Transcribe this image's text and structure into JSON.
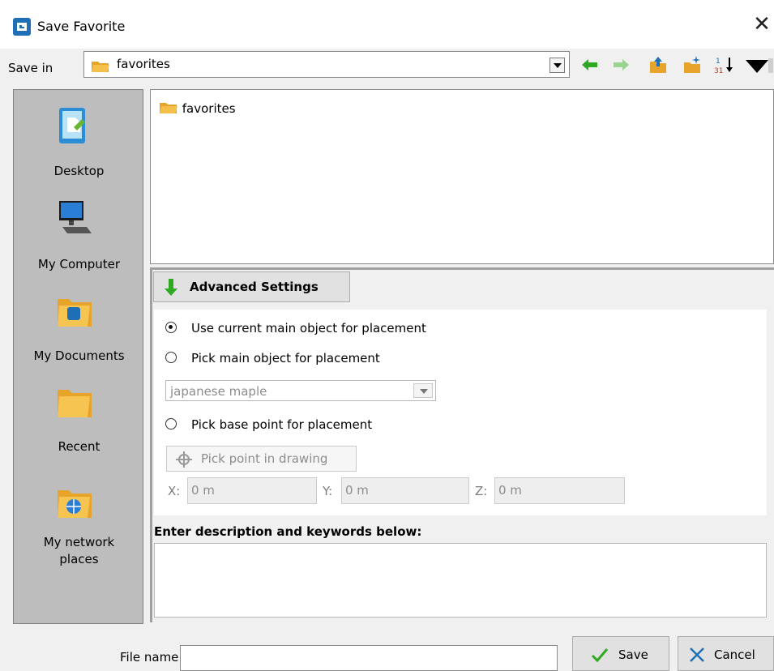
{
  "window": {
    "title": "Save Favorite",
    "close_glyph": "✕"
  },
  "save_in": {
    "label": "Save in",
    "value": "favorites"
  },
  "toolbar": {
    "icons": [
      "back-arrow-icon",
      "forward-arrow-icon",
      "up-folder-icon",
      "new-folder-icon",
      "sort-icon",
      "view-menu-icon"
    ],
    "colors": {
      "back": "#2eaa22",
      "forward": "#9ad28f"
    }
  },
  "places": [
    {
      "label": "Desktop",
      "icon": "desktop-icon"
    },
    {
      "label": "My Computer",
      "icon": "computer-icon"
    },
    {
      "label": "My Documents",
      "icon": "documents-folder-icon"
    },
    {
      "label": "Recent",
      "icon": "recent-folder-icon"
    },
    {
      "label": "My network\nplaces",
      "icon": "network-places-icon"
    }
  ],
  "file_list": {
    "items": [
      {
        "name": "favorites",
        "icon": "folder-icon"
      }
    ]
  },
  "advanced": {
    "header": "Advanced Settings",
    "options": [
      {
        "label": "Use current main object for placement",
        "selected": true
      },
      {
        "label": "Pick main object for placement",
        "selected": false
      },
      {
        "label": "Pick base point for placement",
        "selected": false
      }
    ],
    "object_select": {
      "value": "japanese maple"
    },
    "pick_point_button": "Pick point in drawing",
    "coords": [
      {
        "label": "X:",
        "value": "0 m"
      },
      {
        "label": "Y:",
        "value": "0 m"
      },
      {
        "label": "Z:",
        "value": "0 m"
      }
    ],
    "description_label": "Enter description and keywords below:",
    "description_value": ""
  },
  "footer": {
    "file_name_label": "File name:",
    "file_name_value": "",
    "save_label": "Save",
    "cancel_label": "Cancel"
  },
  "colors": {
    "accent": "#1e6fb5",
    "sidebar": "#bdbdbd",
    "folder": "#e8a32a"
  }
}
